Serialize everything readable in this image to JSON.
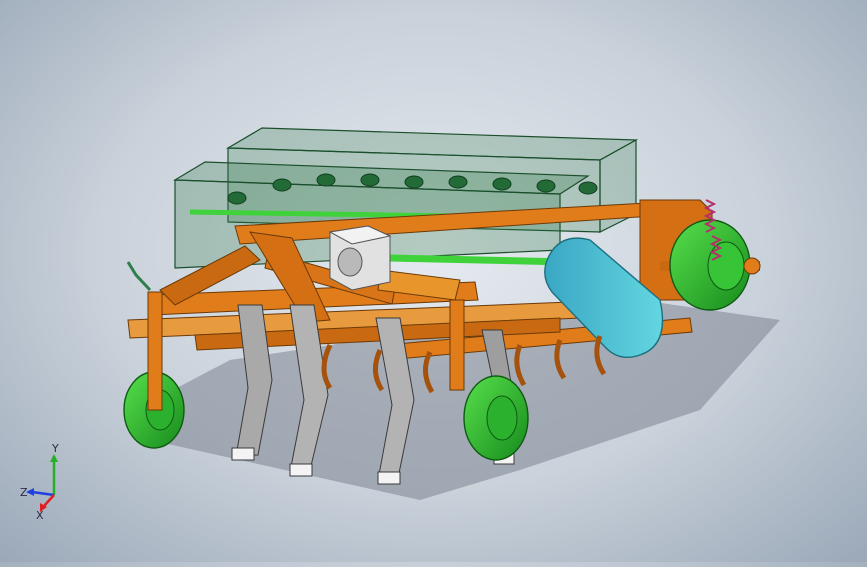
{
  "viewport": {
    "background_top": "#e6eaf0",
    "background_bottom": "#9aa8b8",
    "model_colors": {
      "frame": "#e07c1a",
      "frame_shade": "#a4520c",
      "hopper": "#2f7d4a",
      "shaft": "#3fd23a",
      "wheel": "#29c12e",
      "chain_guard": "#39b6c6",
      "tine_steel": "#8a8a8a",
      "gearbox": "#d9d9d9",
      "spring": "#b5306a"
    }
  },
  "triad": {
    "x_label": "X",
    "y_label": "Y",
    "z_label": "Z",
    "x_color": "#e02020",
    "y_color": "#26b026",
    "z_color": "#2040e0"
  }
}
